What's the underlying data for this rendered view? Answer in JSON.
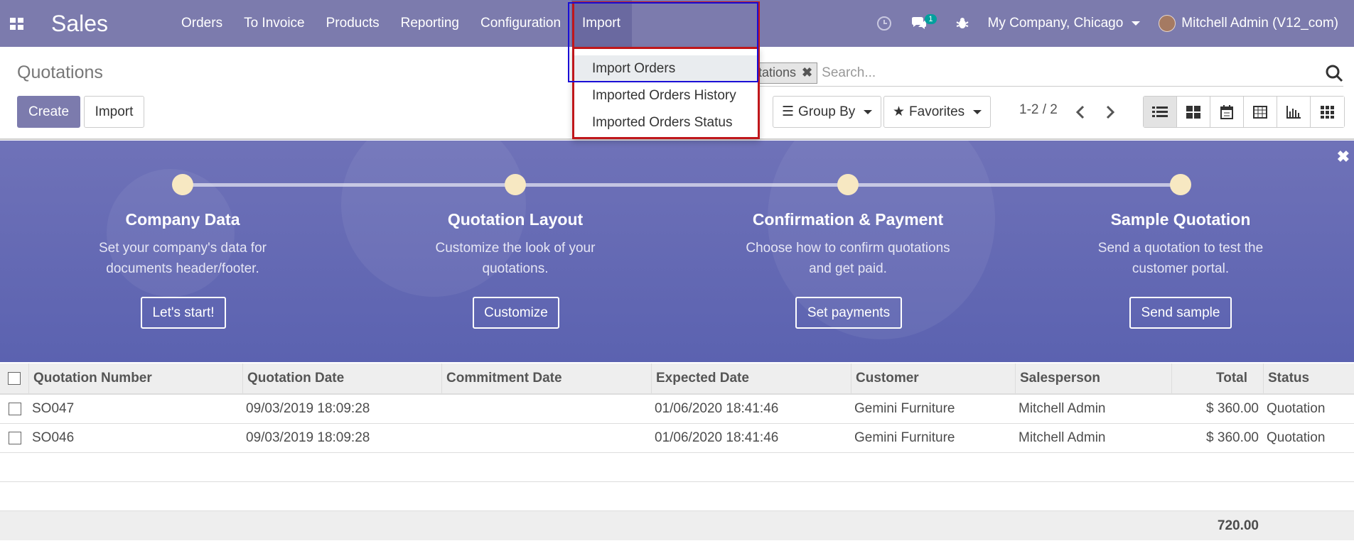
{
  "navbar": {
    "app_name": "Sales",
    "menu": [
      "Orders",
      "To Invoice",
      "Products",
      "Reporting",
      "Configuration",
      "Import"
    ],
    "messages_badge": "1",
    "company": "My Company, Chicago",
    "user": "Mitchell Admin (V12_com)"
  },
  "control": {
    "breadcrumb": "Quotations",
    "create_label": "Create",
    "import_label": "Import",
    "facet_label": "tations",
    "search_placeholder": "Search...",
    "group_by": "Group By",
    "favorites": "Favorites",
    "pager": "1-2 / 2"
  },
  "dropdown": {
    "items": [
      "Import Orders",
      "Imported Orders History",
      "Imported Orders Status"
    ]
  },
  "banner": {
    "steps": [
      {
        "title": "Company Data",
        "desc": "Set your company's data for documents header/footer.",
        "button": "Let's start!"
      },
      {
        "title": "Quotation Layout",
        "desc": "Customize the look of your quotations.",
        "button": "Customize"
      },
      {
        "title": "Confirmation & Payment",
        "desc": "Choose how to confirm quotations and get paid.",
        "button": "Set payments"
      },
      {
        "title": "Sample Quotation",
        "desc": "Send a quotation to test the customer portal.",
        "button": "Send sample"
      }
    ]
  },
  "table": {
    "headers": [
      "Quotation Number",
      "Quotation Date",
      "Commitment Date",
      "Expected Date",
      "Customer",
      "Salesperson",
      "Total",
      "Status"
    ],
    "rows": [
      [
        "SO047",
        "09/03/2019 18:09:28",
        "",
        "01/06/2020 18:41:46",
        "Gemini Furniture",
        "Mitchell Admin",
        "$ 360.00",
        "Quotation"
      ],
      [
        "SO046",
        "09/03/2019 18:09:28",
        "",
        "01/06/2020 18:41:46",
        "Gemini Furniture",
        "Mitchell Admin",
        "$ 360.00",
        "Quotation"
      ]
    ],
    "footer_total": "720.00"
  },
  "colors": {
    "brand": "#7c7bad",
    "highlight_red": "#c0171b",
    "highlight_blue": "#1a0ed6"
  }
}
